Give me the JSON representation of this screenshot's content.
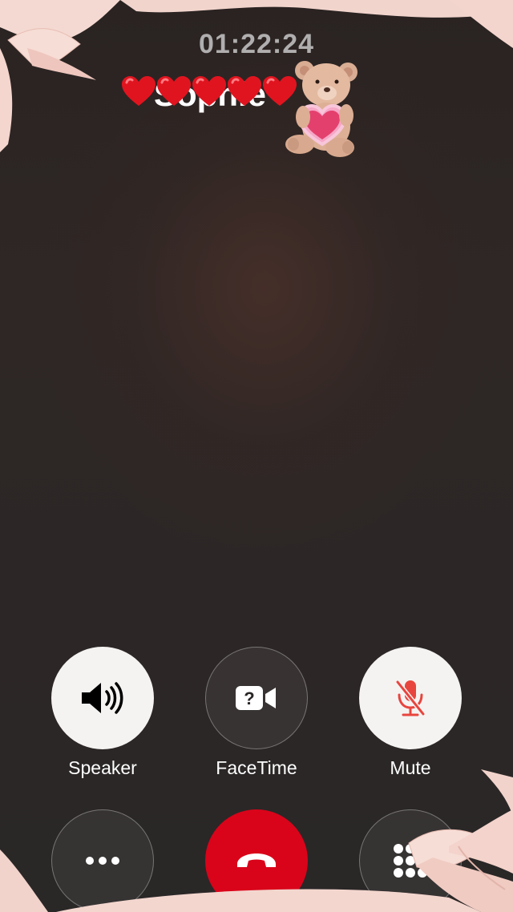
{
  "call": {
    "timer": "01:22:24",
    "caller_name": "Sophie"
  },
  "decorations": {
    "heart_emoji": "heart-icon",
    "heart_count": 5,
    "sticker": "teddy-bear-with-heart",
    "ribbon_color": "#f3d0c8"
  },
  "controls": {
    "row1": [
      {
        "key": "speaker",
        "label": "Speaker",
        "icon": "speaker-icon",
        "style": "light"
      },
      {
        "key": "facetime",
        "label": "FaceTime",
        "icon": "facetime-unavailable-icon",
        "style": "dark"
      },
      {
        "key": "mute",
        "label": "Mute",
        "icon": "mic-muted-icon",
        "style": "light"
      }
    ],
    "row2": [
      {
        "key": "more",
        "icon": "more-icon",
        "style": "dark"
      },
      {
        "key": "end_call",
        "icon": "end-call-icon",
        "style": "red"
      },
      {
        "key": "keypad",
        "icon": "keypad-icon",
        "style": "dark"
      }
    ]
  },
  "colors": {
    "end_call": "#d9041a",
    "mute_icon": "#e8453e",
    "background": "#2b2727"
  }
}
